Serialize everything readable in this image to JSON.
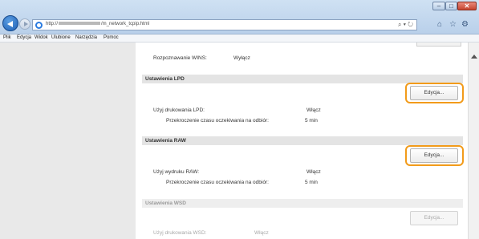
{
  "browser": {
    "url_prefix": "http://",
    "url_suffix": "/m_network_tcpip.html",
    "addr_tools": "⌕ ▾ ↻",
    "toolbar_icons": [
      "⌂",
      "☆",
      "⚙"
    ],
    "menu": [
      "Plik",
      "Edycja",
      "Widok",
      "Ulubione",
      "Narzędzia",
      "Pomoc"
    ],
    "window_controls": {
      "minimize": "–",
      "maximize": "□",
      "close": "✕"
    }
  },
  "page": {
    "wins_label": "Rozpoznawanie WINS:",
    "wins_value": "Wyłącz",
    "lpd": {
      "header": "Ustawienia LPD",
      "edit": "Edycja...",
      "use_label": "Użyj drukowania LPD:",
      "use_value": "Włącz",
      "timeout_label": "Przekroczenie czasu oczekiwania na odbiór:",
      "timeout_value": "5 min"
    },
    "raw": {
      "header": "Ustawienia RAW",
      "edit": "Edycja...",
      "use_label": "Użyj wydruku RAW:",
      "use_value": "Włącz",
      "timeout_label": "Przekroczenie czasu oczekiwania na odbiór:",
      "timeout_value": "5 min"
    },
    "wsd": {
      "header": "Ustawienia WSD",
      "edit": "Edycja...",
      "use_label": "Użyj drukowania WSD:",
      "use_value": "Włącz"
    }
  },
  "colors": {
    "highlight": "#f29b1a"
  }
}
